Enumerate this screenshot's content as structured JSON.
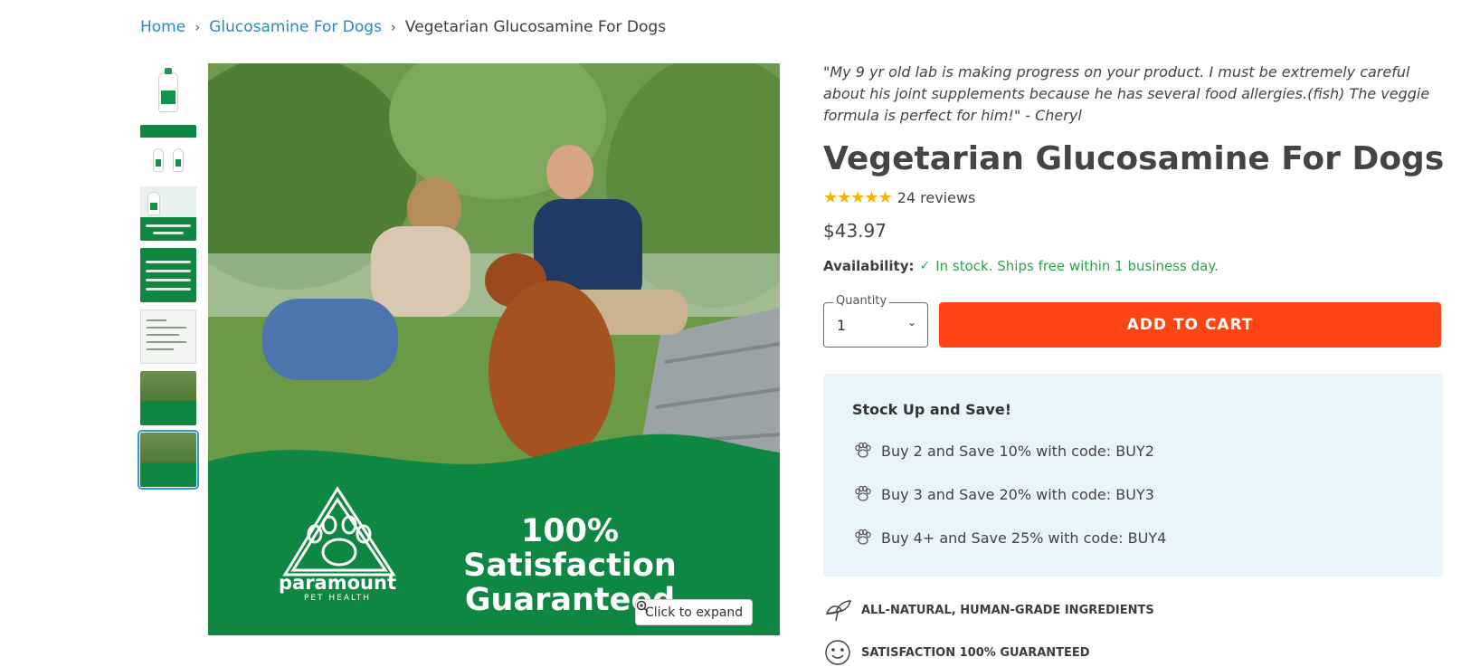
{
  "breadcrumb": {
    "home": "Home",
    "category": "Glucosamine For Dogs",
    "current": "Vegetarian Glucosamine For Dogs",
    "separator": "›"
  },
  "thumbnails": [
    {
      "name": "thumbnail-bottle",
      "active": false
    },
    {
      "name": "thumbnail-comparison",
      "active": false
    },
    {
      "name": "thumbnail-dogs-love",
      "active": false
    },
    {
      "name": "thumbnail-benefits",
      "active": false
    },
    {
      "name": "thumbnail-label",
      "active": false
    },
    {
      "name": "thumbnail-lifestyle",
      "active": false
    },
    {
      "name": "thumbnail-satisfaction",
      "active": true
    }
  ],
  "main_image": {
    "headline_line1": "100% Satisfaction",
    "headline_line2": "Guaranteed",
    "brand_name": "paramount",
    "brand_sub": "PET HEALTH",
    "expand_label": "Click to expand"
  },
  "product": {
    "testimonial": "\"My 9 yr old lab is making progress on your product. I must be extremely careful about his joint supplements because he has several food allergies.(fish) The veggie formula is perfect for him!\" - Cheryl",
    "title": "Vegetarian Glucosamine For Dogs",
    "stars": "★★★★★",
    "reviews": "24 reviews",
    "price": "$43.97",
    "availability_label": "Availability:",
    "availability_text": "In stock. Ships free within 1 business day."
  },
  "cart": {
    "quantity_label": "Quantity",
    "quantity_value": "1",
    "add_to_cart": "ADD TO CART"
  },
  "promo": {
    "title": "Stock Up and Save!",
    "items": [
      "Buy 2 and Save 10% with code: BUY2",
      "Buy 3 and Save 20% with code: BUY3",
      "Buy 4+ and Save 25% with code: BUY4"
    ]
  },
  "features": [
    {
      "icon": "leaf-icon",
      "label": "ALL-NATURAL, HUMAN-GRADE INGREDIENTS"
    },
    {
      "icon": "smile-icon",
      "label": "SATISFACTION 100% GUARANTEED"
    }
  ],
  "colors": {
    "link": "#2a8ab8",
    "brand_green": "#0e8742",
    "cta": "#fc4512",
    "in_stock": "#2ea34a",
    "promo_bg": "#e8f6fb",
    "star": "#f4b400"
  }
}
